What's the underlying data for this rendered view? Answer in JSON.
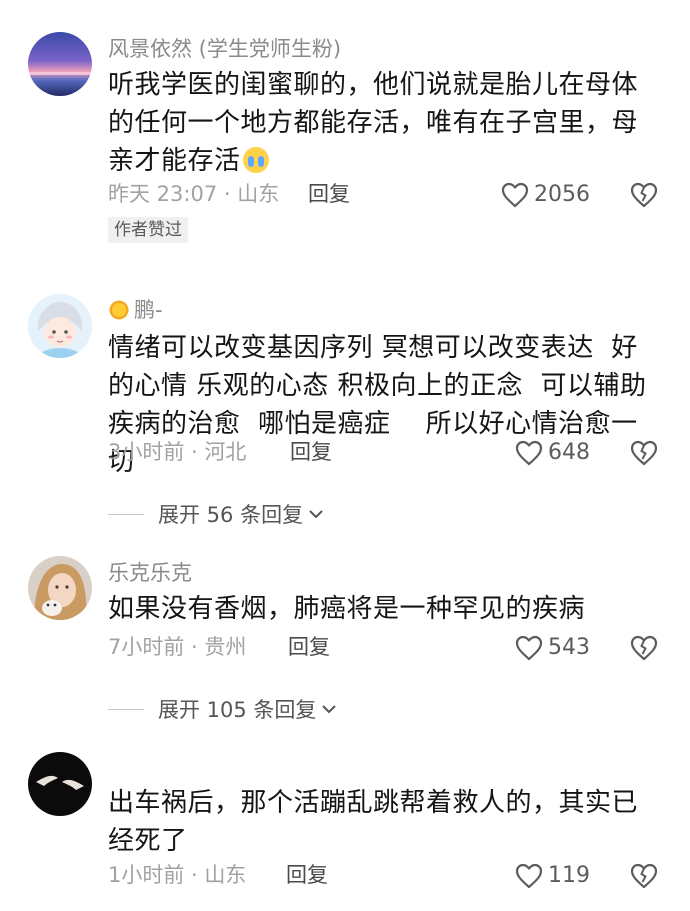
{
  "comments": [
    {
      "username": "风景依然 (学生党师生粉)",
      "content": "听我学医的闺蜜聊的，他们说就是胎儿在母体的任何一个地方都能存活，唯有在子宫里，母亲才能存活",
      "emoji": "crying-face-icon",
      "meta": "昨天 23:07 · 山东",
      "reply_label": "回复",
      "likes": "2056",
      "badge": "作者赞过"
    },
    {
      "username": "鹏-",
      "content": "情绪可以改变基因序列 冥想可以改变表达  好的心情 乐观的心态 积极向上的正念  可以辅助疾病的治愈  哪怕是癌症    所以好心情治愈一切",
      "meta": "3小时前 · 河北",
      "reply_label": "回复",
      "likes": "648",
      "expand_label": "展开 56 条回复"
    },
    {
      "username": "乐克乐克",
      "content": "如果没有香烟，肺癌将是一种罕见的疾病",
      "meta": "7小时前 · 贵州",
      "reply_label": "回复",
      "likes": "543",
      "expand_label": "展开 105 条回复"
    },
    {
      "username": "",
      "content": "出车祸后，那个活蹦乱跳帮着救人的，其实已经死了",
      "meta": "1小时前 · 山东",
      "reply_label": "回复",
      "likes": "119"
    }
  ],
  "colors": {
    "text_primary": "#151515",
    "text_secondary": "#8a8a8a",
    "text_meta": "#a2a2a2"
  }
}
